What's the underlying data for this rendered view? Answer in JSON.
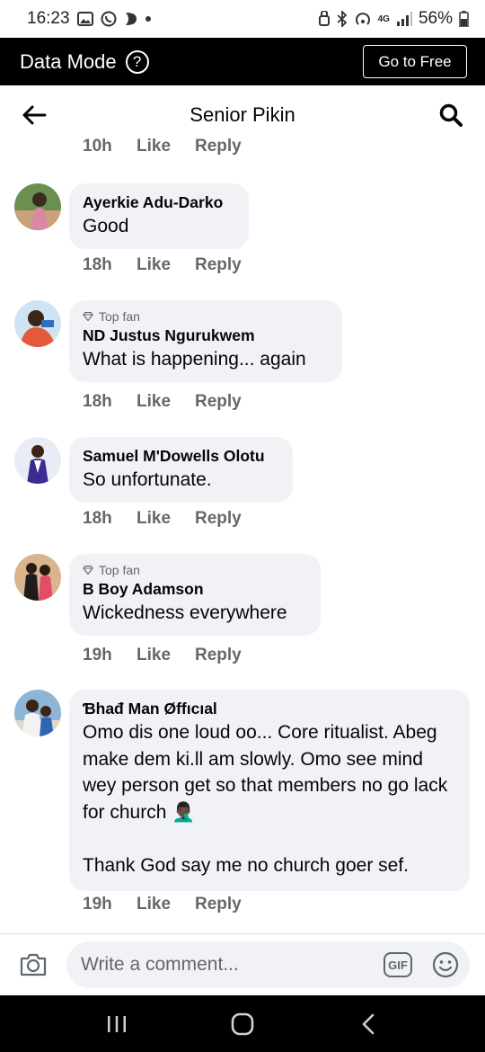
{
  "status_bar": {
    "time": "16:23",
    "battery": "56%",
    "network": "4G"
  },
  "data_bar": {
    "title": "Data Mode",
    "help_glyph": "?",
    "go_free_label": "Go to Free"
  },
  "header": {
    "title": "Senior Pikin"
  },
  "cut_off_actions": {
    "time": "10h",
    "like": "Like",
    "reply": "Reply"
  },
  "comments": [
    {
      "author": "Ayerkie Adu-Darko",
      "badge": "",
      "text": "Good",
      "time": "18h",
      "like": "Like",
      "reply": "Reply",
      "avatar_color": "#4a7a3a"
    },
    {
      "author": "ND Justus Ngurukwem",
      "badge": "Top fan",
      "text": "What is happening... again",
      "time": "18h",
      "like": "Like",
      "reply": "Reply",
      "avatar_color": "#3b78c2"
    },
    {
      "author": "Samuel M'Dowells Olotu",
      "badge": "",
      "text": "So unfortunate.",
      "time": "18h",
      "like": "Like",
      "reply": "Reply",
      "avatar_color": "#5a4bb5"
    },
    {
      "author": "B Boy Adamson",
      "badge": "Top fan",
      "text": "Wickedness everywhere",
      "time": "19h",
      "like": "Like",
      "reply": "Reply",
      "avatar_color": "#b06c4a"
    },
    {
      "author": "Ɓhađ Man Øffıcıal",
      "badge": "",
      "text": "Omo dis one loud oo... Core ritualist. Abeg make dem ki.ll am slowly. Omo see mind wey person get so that members no go lack for church 🤦🏿‍♂️\n\nThank God say me no church goer sef.",
      "time": "19h",
      "like": "Like",
      "reply": "Reply",
      "avatar_color": "#6a8fb0"
    }
  ],
  "composer": {
    "placeholder": "Write a comment...",
    "gif_label": "GIF"
  },
  "icons": {
    "back": "arrow-left-icon",
    "search": "search-icon",
    "camera": "camera-icon",
    "emoji": "smiley-icon",
    "nav_recents": "recents-icon",
    "nav_home": "home-icon",
    "nav_back": "nav-back-icon"
  }
}
